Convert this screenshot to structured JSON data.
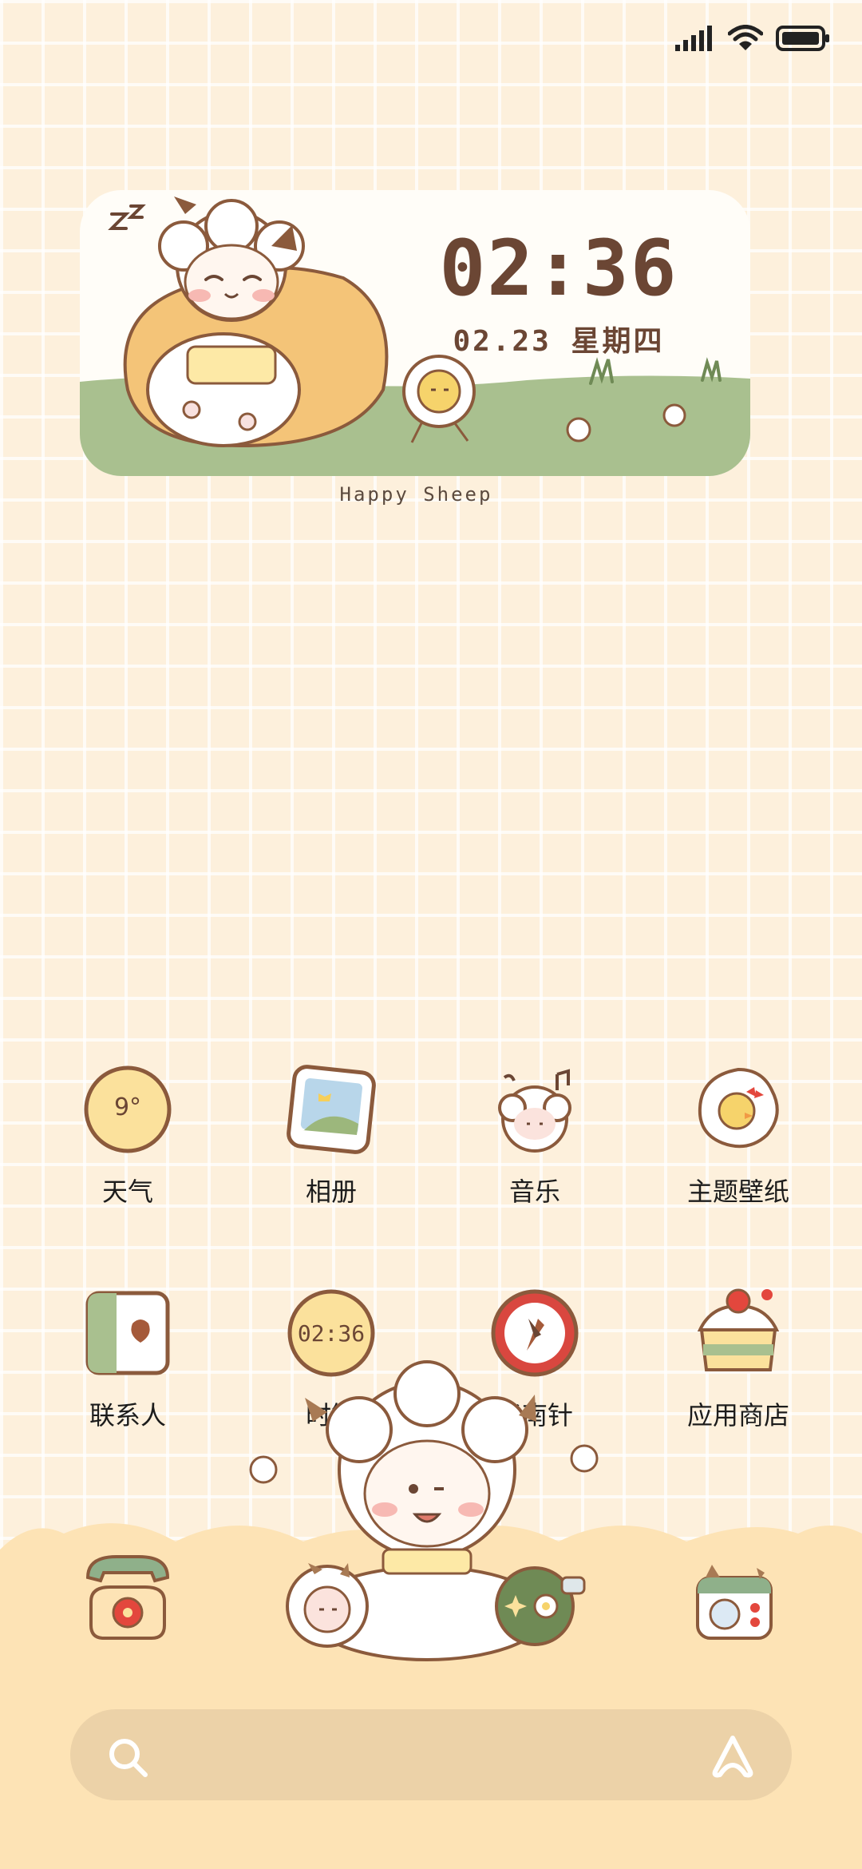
{
  "status_bar": {
    "signal": "signal-icon",
    "wifi": "wifi-icon",
    "battery": "battery-icon"
  },
  "widget": {
    "time": "02:36",
    "date": "02.23 星期四",
    "caption": "Happy Sheep"
  },
  "apps": [
    {
      "label": "天气",
      "icon": "weather-icon",
      "icon_text": "9°"
    },
    {
      "label": "相册",
      "icon": "gallery-icon"
    },
    {
      "label": "音乐",
      "icon": "music-icon"
    },
    {
      "label": "主题壁纸",
      "icon": "themes-icon"
    },
    {
      "label": "联系人",
      "icon": "contacts-icon"
    },
    {
      "label": "时钟",
      "icon": "clock-icon",
      "icon_text": "02:36"
    },
    {
      "label": "指南针",
      "icon": "compass-icon"
    },
    {
      "label": "应用商店",
      "icon": "app-store-icon"
    }
  ],
  "dock": [
    {
      "icon": "phone-icon"
    },
    {
      "icon": "messages-icon"
    },
    {
      "icon": "browser-icon"
    },
    {
      "icon": "camera-icon"
    }
  ],
  "search": {
    "icon": "search-icon",
    "assistant": "assistant-icon"
  }
}
